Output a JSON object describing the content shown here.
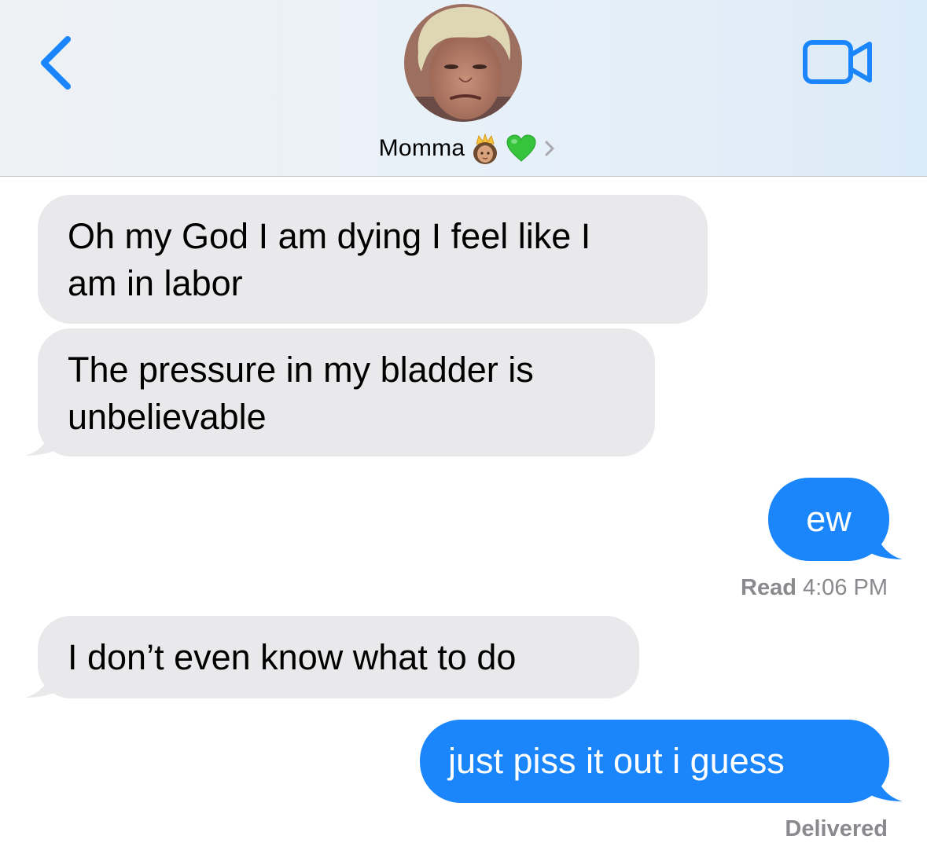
{
  "header": {
    "contact_name": "Momma",
    "icons": {
      "back": "chevron-left-icon",
      "video": "video-camera-icon",
      "emoji_1": "princess-emoji-icon",
      "emoji_2": "green-heart-emoji-icon",
      "chevron": "chevron-right-icon"
    }
  },
  "messages": [
    {
      "direction": "received",
      "text_line1": "Oh my God I am dying I feel like I",
      "text_line2": "am in labor"
    },
    {
      "direction": "received",
      "text_line1": "The pressure in my bladder is",
      "text_line2": "unbelievable"
    },
    {
      "direction": "sent",
      "text": "ew"
    },
    {
      "direction": "received",
      "text": "I don’t even know what to do"
    },
    {
      "direction": "sent",
      "text": "just piss it out i guess"
    }
  ],
  "status_read": {
    "label": "Read",
    "time": "4:06 PM"
  },
  "status_delivered": "Delivered",
  "colors": {
    "accent_blue": "#1b86fc",
    "received_bubble": "#e9e9eb",
    "status_gray": "#8a8a8e"
  }
}
